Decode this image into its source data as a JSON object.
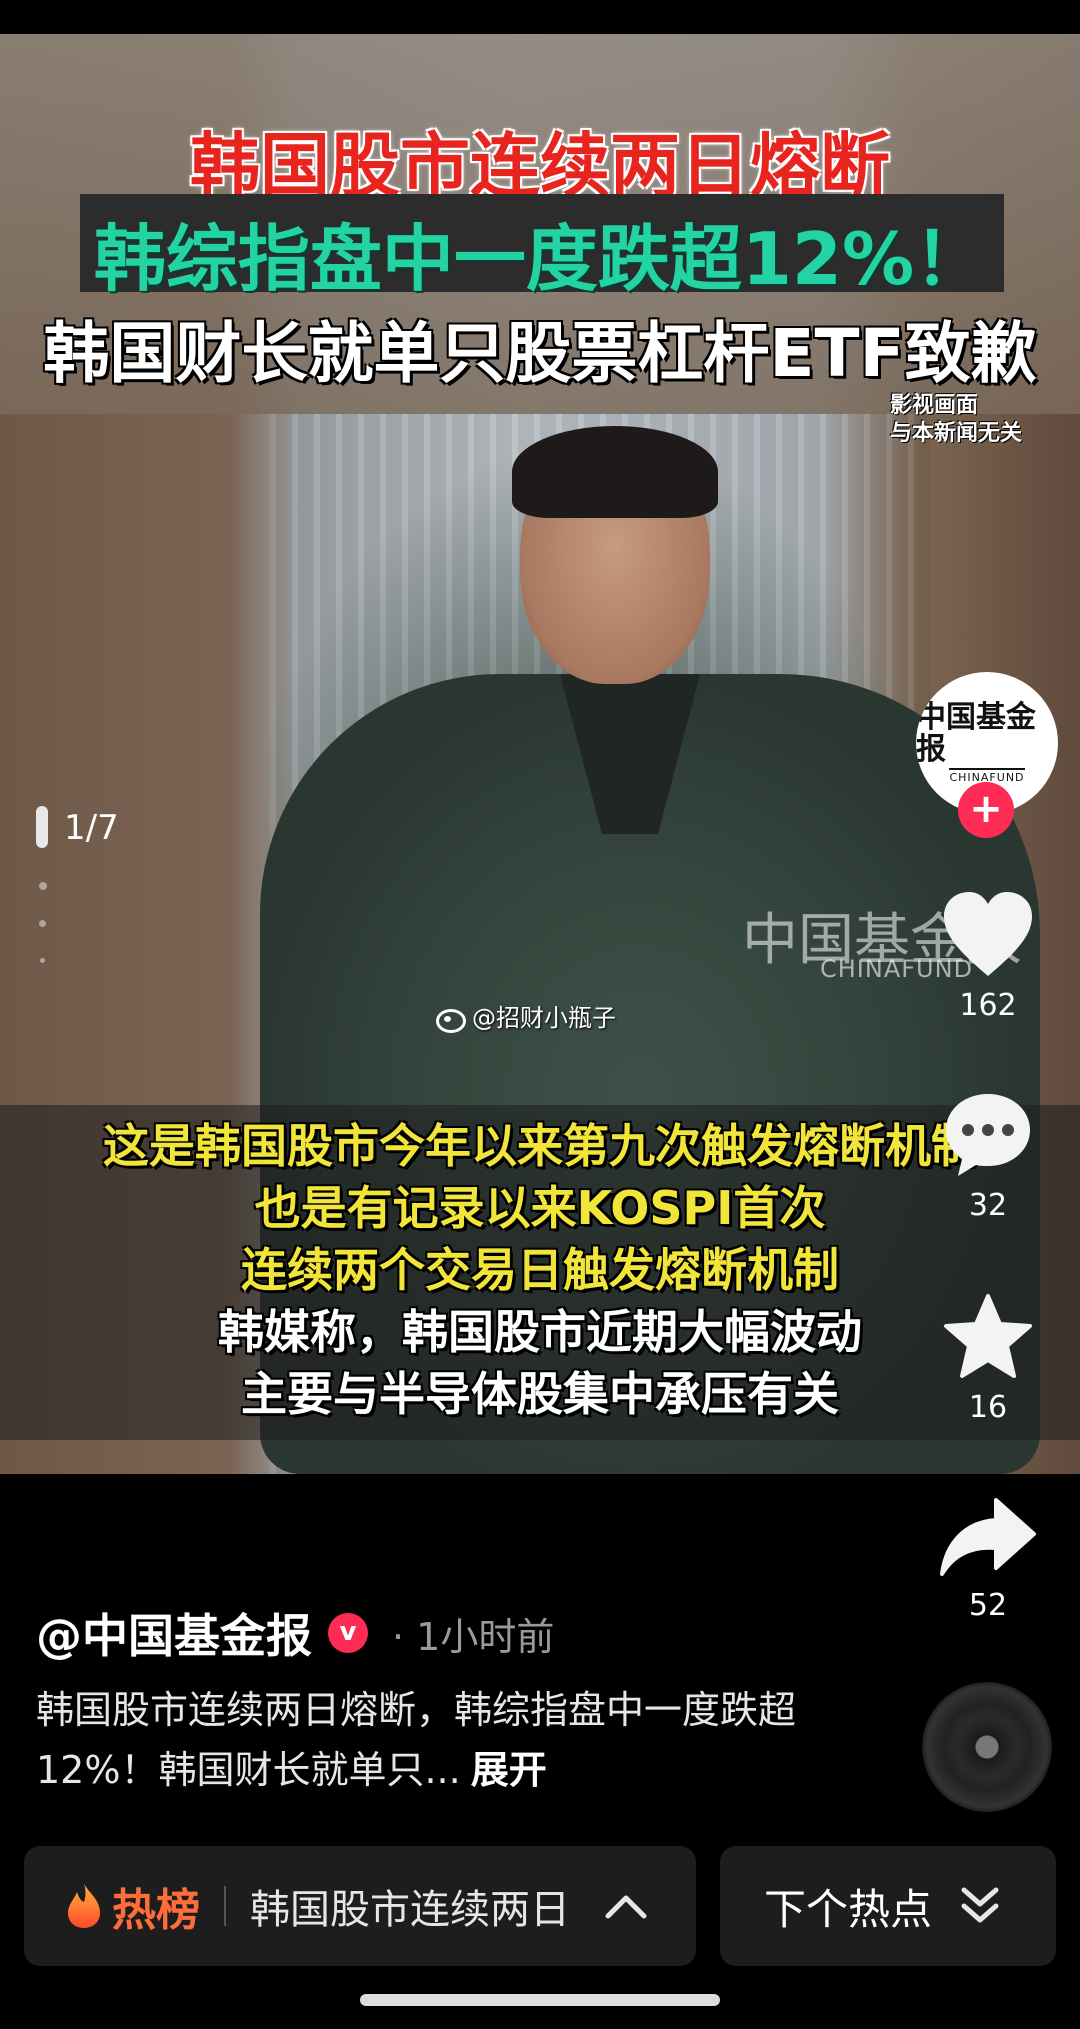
{
  "video": {
    "headline_1": "韩国股市连续两日熔断",
    "headline_2": "韩综指盘中一度跌超12%！",
    "headline_3": "韩国财长就单只股票杠杆ETF致歉",
    "disclaimer_line_1": "影视画面",
    "disclaimer_line_2": "与本新闻无关",
    "watermark_cn": "中国基金报",
    "watermark_en": "CHINAFUND",
    "weibo_handle": "@招财小瓶子",
    "subtitles": [
      "这是韩国股市今年以来第九次触发熔断机制",
      "也是有记录以来KOSPI首次",
      "连续两个交易日触发熔断机制",
      "韩媒称，韩国股市近期大幅波动",
      "主要与半导体股集中承压有关"
    ]
  },
  "pager": {
    "label": "1/7"
  },
  "avatar": {
    "name_cn": "中国基金报",
    "name_en": "CHINAFUND"
  },
  "actions": {
    "likes": "162",
    "comments": "32",
    "favorites": "16",
    "shares": "52"
  },
  "post": {
    "author": "@中国基金报",
    "verified_mark": "v",
    "time": "· 1小时前",
    "caption": "韩国股市连续两日熔断，韩综指盘中一度跌超12%！韩国财长就单只...",
    "expand": "展开"
  },
  "bottom": {
    "hot_label": "热榜",
    "hot_title": "韩国股市连续两日",
    "next_label": "下个热点"
  },
  "colors": {
    "accent_red": "#fe2c55",
    "hot_orange": "#ff6d3a",
    "headline_red": "#e8241f",
    "headline_green": "#23d3a3",
    "subtitle_yellow": "#f2e53a"
  }
}
